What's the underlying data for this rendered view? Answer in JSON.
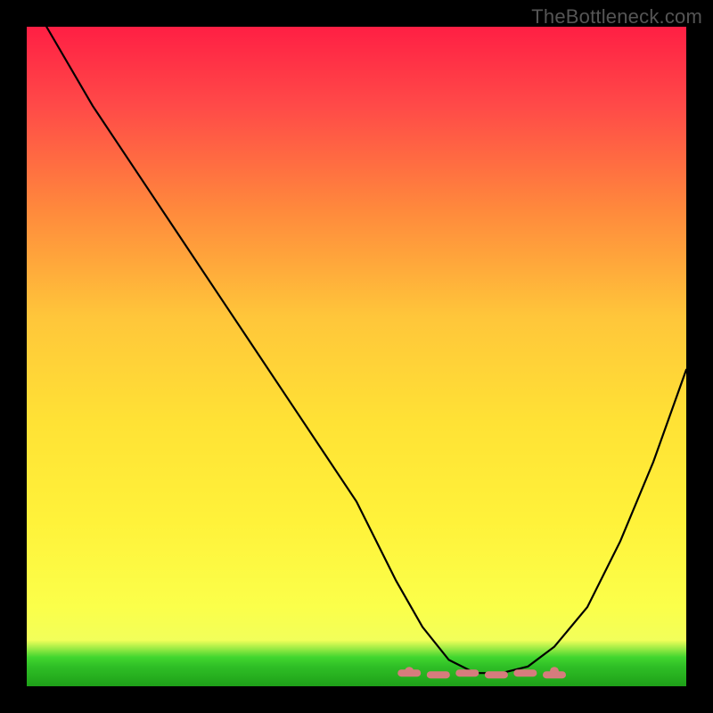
{
  "watermark": "TheBottleneck.com",
  "chart_data": {
    "type": "line",
    "title": "",
    "xlabel": "",
    "ylabel": "",
    "xlim": [
      0,
      100
    ],
    "ylim": [
      0,
      100
    ],
    "grid": false,
    "legend": false,
    "series": [
      {
        "name": "curve",
        "x": [
          3,
          10,
          20,
          30,
          40,
          50,
          56,
          60,
          64,
          68,
          72,
          76,
          80,
          85,
          90,
          95,
          100
        ],
        "y": [
          100,
          88,
          73,
          58,
          43,
          28,
          16,
          9,
          4,
          2,
          2,
          3,
          6,
          12,
          22,
          34,
          48
        ]
      }
    ],
    "optimal_band": {
      "x_start": 58,
      "x_end": 80,
      "y": 2
    },
    "background": {
      "type": "vertical-gradient",
      "stops": [
        {
          "pos": 0,
          "color": "#ff1f44"
        },
        {
          "pos": 0.28,
          "color": "#ff8a3c"
        },
        {
          "pos": 0.6,
          "color": "#ffe235"
        },
        {
          "pos": 0.93,
          "color": "#f2ff5a"
        },
        {
          "pos": 0.96,
          "color": "#42d62f"
        },
        {
          "pos": 1.0,
          "color": "#1ea018"
        }
      ]
    }
  }
}
